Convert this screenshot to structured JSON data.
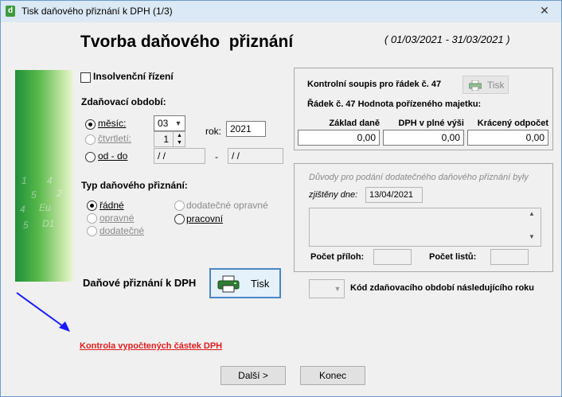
{
  "window": {
    "title": "Tisk daňového přiznání k DPH (1/3)",
    "app_icon": "d",
    "close_glyph": "✕"
  },
  "header": {
    "title": "Tvorba daňového  přiznání",
    "period": "( 01/03/2021 - 31/03/2021 )"
  },
  "side_image": {
    "glyphs": [
      "1",
      "4",
      "5",
      "2",
      "4",
      "Eu",
      "5",
      "D1"
    ]
  },
  "insolvency": {
    "label": "Insolvenční řízení",
    "checked": false
  },
  "tax_period": {
    "heading": "Zdaňovací období:",
    "month_label": "měsíc:",
    "month_value": "03",
    "quarter_label": "čtvrtletí:",
    "quarter_value": "1",
    "from_to_label": "od - do",
    "from_value": "/ /",
    "dash": "-",
    "to_value": "/ /",
    "year_label": "rok:",
    "year_value": "2021"
  },
  "return_type": {
    "heading": "Typ daňového přiznání:",
    "regular": "řádné",
    "corrective": "opravné",
    "supplementary": "dodatečné",
    "supplementary_corrective": "dodatečné opravné",
    "working": "pracovní"
  },
  "print_section": {
    "label": "Daňové přiznání k DPH",
    "button": "Tisk"
  },
  "control_panel": {
    "title": "Kontrolní soupis pro řádek č. 47",
    "print_button": "Tisk",
    "line_label": "Řádek č. 47 Hodnota pořízeného majetku:",
    "columns": [
      "Základ daně",
      "DPH v plné výši",
      "Krácený odpočet"
    ],
    "values": [
      "0,00",
      "0,00",
      "0,00"
    ]
  },
  "supplementary_panel": {
    "reason_label": "Důvody pro podání dodatečného daňového přiznání byly",
    "found_label": "zjištěny dne:",
    "found_date": "13/04/2021",
    "attachments_label": "Počet příloh:",
    "sheets_label": "Počet listů:"
  },
  "next_year": {
    "label": "Kód zdaňovacího období následujícího roku"
  },
  "check_link": "Kontrola vypočtených částek DPH",
  "footer": {
    "next_button": "Další >",
    "end_button": "Konec"
  },
  "colors": {
    "title_bar": "#dbe8f5",
    "accent_arrow": "#1a1aff",
    "link": "#e21c1c",
    "side_green": "#2e9e3e"
  }
}
